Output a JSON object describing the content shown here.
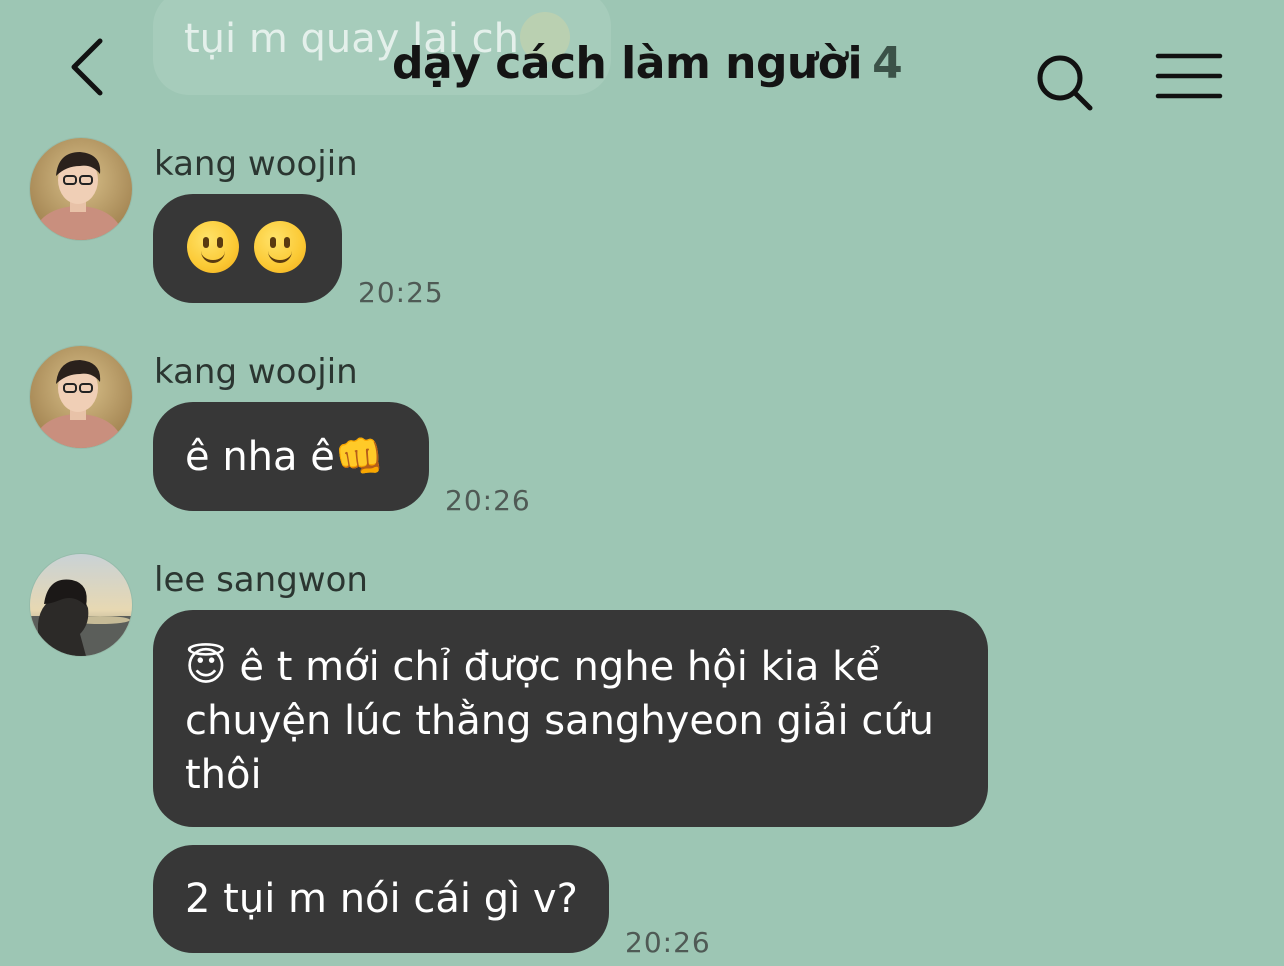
{
  "background_color": "#9dc6b4",
  "bubble_color": "#373737",
  "previous_message": {
    "text": "tụi m quay lại ch",
    "emoji": "grinning-sweat-emoji"
  },
  "header": {
    "back_icon": "chevron-left-icon",
    "title": "dạy cách làm người",
    "member_count": "4",
    "search_icon": "search-icon",
    "menu_icon": "hamburger-menu-icon"
  },
  "messages": [
    {
      "sender": "kang woojin",
      "avatar": "avatar-kang-woojin",
      "bubbles": [
        {
          "text": "🙂🙂",
          "emoji": "slightly-smiling-face-icon"
        }
      ],
      "time": "20:25"
    },
    {
      "sender": "kang woojin",
      "avatar": "avatar-kang-woojin",
      "bubbles": [
        {
          "text": "ê nha ê👊"
        }
      ],
      "time": "20:26"
    },
    {
      "sender": "lee sangwon",
      "avatar": "avatar-lee-sangwon",
      "bubbles": [
        {
          "text": "😇 ê t mới chỉ được nghe hội kia kể chuyện lúc thằng sanghyeon giải cứu thôi"
        },
        {
          "text": "2 tụi m nói cái gì v?"
        }
      ],
      "time": "20:26"
    }
  ]
}
